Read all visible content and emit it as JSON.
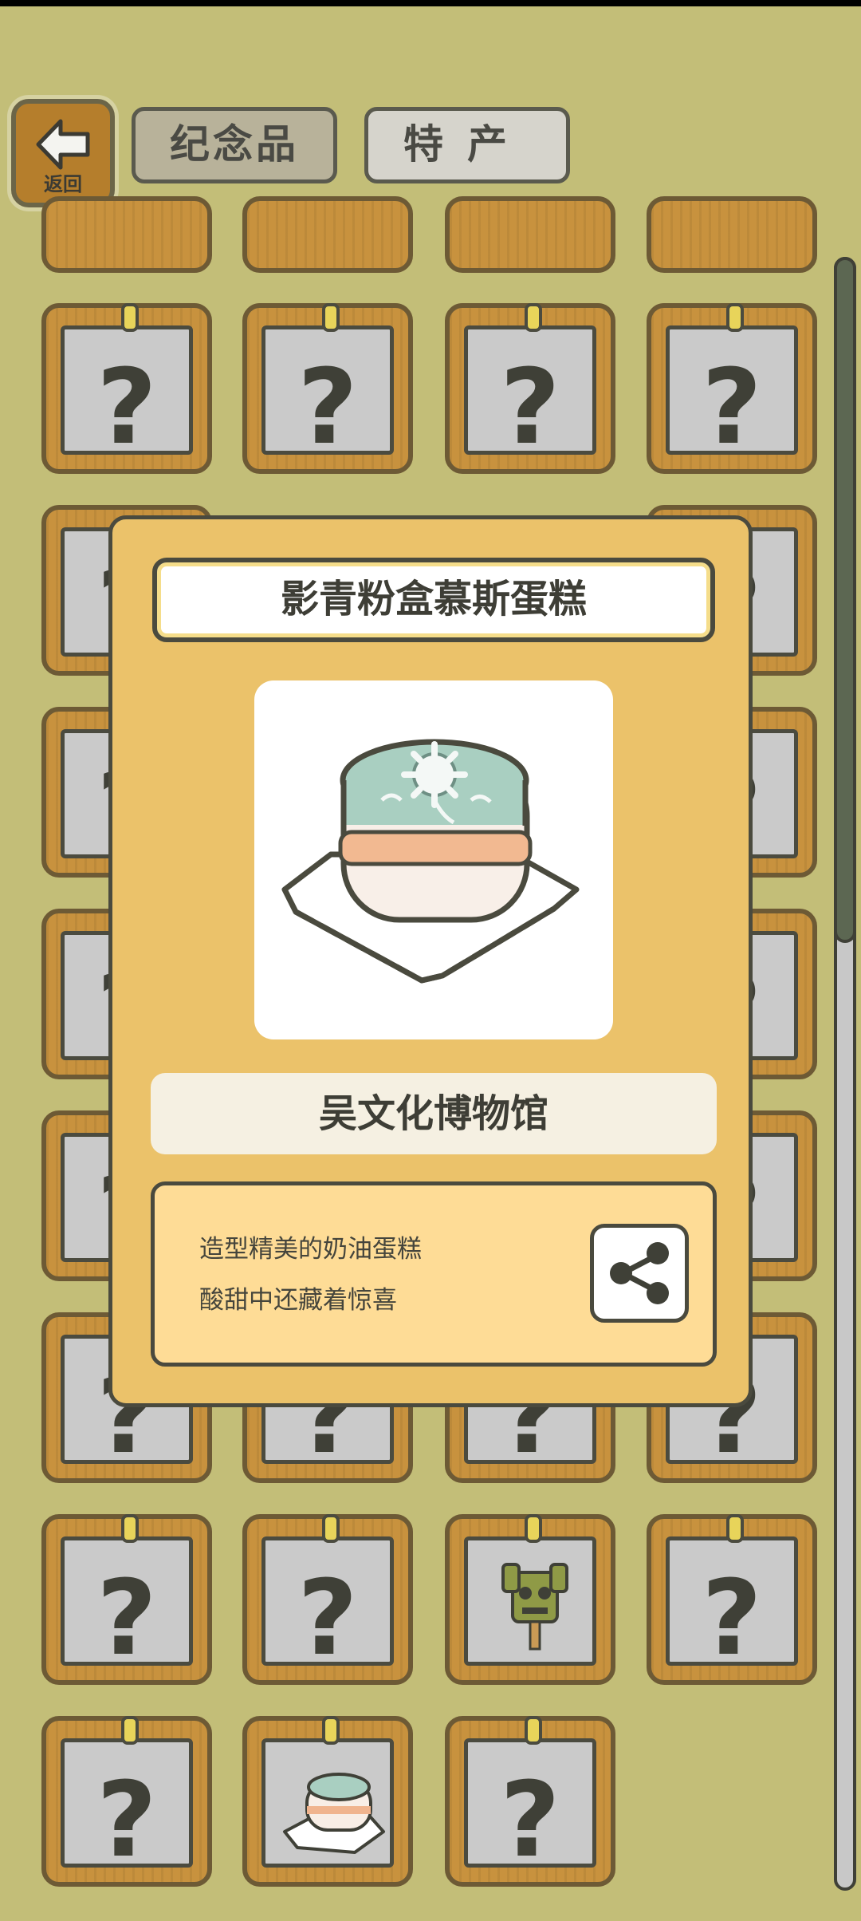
{
  "nav": {
    "back_label": "返回",
    "tabs": [
      "纪念品",
      "特产"
    ],
    "selected_tab": "纪念品"
  },
  "grid": {
    "unknown_symbol": "?",
    "visible_item_icons": [
      "bronze-mask-souvenir-icon",
      "mousse-cake-souvenir-icon"
    ]
  },
  "modal": {
    "title": "影青粉盒慕斯蛋糕",
    "item_icon": "celadon-mousse-cake-illustration",
    "location": "吴文化博物馆",
    "description": [
      "造型精美的奶油蛋糕",
      "酸甜中还藏着惊喜"
    ],
    "share_icon": "share-icon"
  },
  "colors": {
    "background": "#c3be78",
    "modal": "#ebc26a",
    "desc_box": "#fedc96",
    "frame_wood": "#c8923e"
  }
}
